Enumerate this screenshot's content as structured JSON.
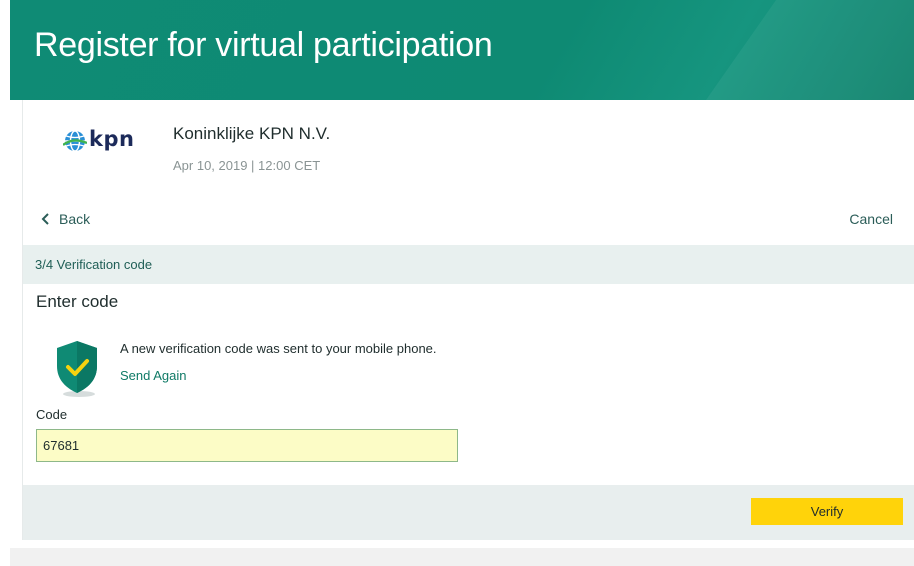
{
  "header": {
    "title": "Register for virtual participation"
  },
  "company": {
    "logo_text": "kpn",
    "name": "Koninklijke KPN N.V.",
    "meeting_date": "Apr 10, 2019 | 12:00 CET"
  },
  "nav": {
    "back_label": "Back",
    "cancel_label": "Cancel"
  },
  "step": {
    "label": "3/4 Verification code"
  },
  "form": {
    "section_title": "Enter code",
    "info_text": "A new verification code was sent to your mobile phone.",
    "send_again_label": "Send Again",
    "code_label": "Code",
    "code_value": "67681"
  },
  "actions": {
    "verify_label": "Verify"
  },
  "colors": {
    "header_bg": "#0e8a73",
    "accent_green": "#0f7a66",
    "step_bar_bg": "#e8f0ef",
    "input_bg": "#fcfcc6",
    "verify_bg": "#ffd30a"
  },
  "icons": {
    "logo": "kpn-globe-icon",
    "back": "chevron-left-icon",
    "shield": "shield-check-icon"
  }
}
